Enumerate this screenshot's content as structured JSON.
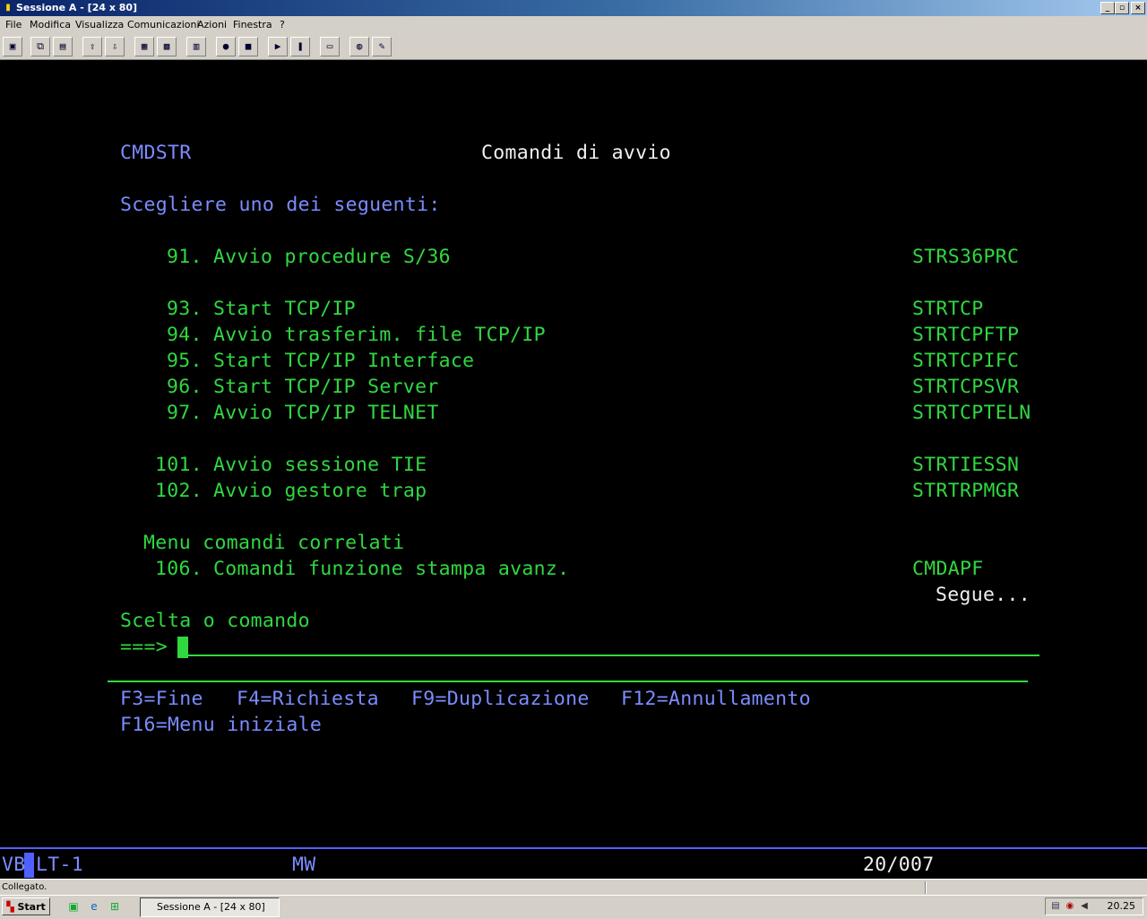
{
  "window": {
    "title": "Sessione A - [24 x 80]",
    "buttons": [
      "_",
      "▫",
      "×"
    ]
  },
  "menu": [
    "File",
    "Modifica",
    "Visualizza",
    "Comunicazioni",
    "Azioni",
    "Finestra",
    "?"
  ],
  "toolbar_icons": [
    "print-screen-icon",
    "copy-icon",
    "paste-icon",
    "send-icon",
    "receive-icon",
    "display-icon",
    "keyboard-icon",
    "macro-icon",
    "record-icon",
    "stop-icon",
    "play-icon",
    "pause-icon",
    "clipboard-icon",
    "globe-icon",
    "edit-icon"
  ],
  "terminal": {
    "screen_id": "CMDSTR",
    "title": "Comandi di avvio",
    "prompt": "Scegliere uno dei seguenti:",
    "options": [
      {
        "num": "91.",
        "label": "Avvio procedure S/36",
        "cmd": "STRS36PRC"
      },
      {
        "num": "93.",
        "label": "Start TCP/IP",
        "cmd": "STRTCP"
      },
      {
        "num": "94.",
        "label": "Avvio trasferim. file TCP/IP",
        "cmd": "STRTCPFTP"
      },
      {
        "num": "95.",
        "label": "Start TCP/IP Interface",
        "cmd": "STRTCPIFC"
      },
      {
        "num": "96.",
        "label": "Start TCP/IP Server",
        "cmd": "STRTCPSVR"
      },
      {
        "num": "97.",
        "label": "Avvio TCP/IP TELNET",
        "cmd": "STRTCPTELN"
      },
      {
        "num": "101.",
        "label": "Avvio sessione TIE",
        "cmd": "STRTIESSN"
      },
      {
        "num": "102.",
        "label": "Avvio gestore trap",
        "cmd": "STRTRPMGR"
      },
      {
        "num": "106.",
        "label": "Comandi funzione stampa avanz.",
        "cmd": "CMDAPF"
      }
    ],
    "related_header": "Menu comandi correlati",
    "more": "Segue...",
    "command_label": "Scelta o comando",
    "command_arrow": "===>",
    "command_value": "",
    "fkeys": [
      "F3=Fine",
      "F4=Richiesta",
      "F9=Duplicazione",
      "F12=Annullamento",
      "F16=Menu iniziale"
    ]
  },
  "oia": {
    "left": "VB",
    "session": "LT-1",
    "mode": "MW",
    "cursor_pos": "20/007"
  },
  "status": "Collegato.",
  "taskbar": {
    "start": "Start",
    "task": "Sessione A - [24 x 80]",
    "clock": "20.25"
  }
}
